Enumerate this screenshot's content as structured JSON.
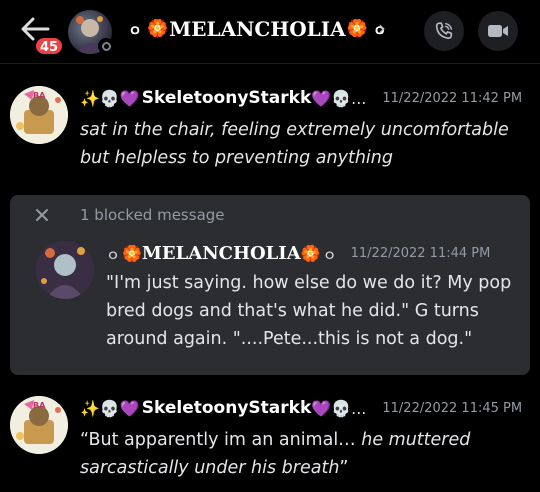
{
  "header": {
    "unread_count": "45",
    "title": "MELANCHOLIA",
    "title_prefix": "ｏ",
    "title_suffix": "ｏ",
    "flower": "🏵️",
    "chevron": "›"
  },
  "messages": [
    {
      "emoji_prefix": "✨💀💜",
      "username": "SkeletoonyStarkk",
      "emoji_suffix": "💜💀...",
      "timestamp": "11/22/2022 11:42 PM",
      "text_italic": "sat in the chair, feeling extremely uncomfortable but helpless to preventing anything"
    },
    {
      "emoji_prefix": "✨💀💜",
      "username": "SkeletoonyStarkk",
      "emoji_suffix": "💜💀...",
      "timestamp": "11/22/2022 11:45 PM",
      "text_plain": "“But apparently im an animal… ",
      "text_italic": "he muttered sarcastically under his breath",
      "text_end": "”"
    }
  ],
  "blocked": {
    "label": "1 blocked message",
    "username": "MELANCHOLIA",
    "name_prefix": "ｏ",
    "name_suffix": "ｏ",
    "flower": "🏵️",
    "timestamp": "11/22/2022 11:44 PM",
    "text": "\"I'm just saying. how else do we do it? My pop bred dogs and that's what he did.\" G turns around again. \"....Pete...this is not a dog.\""
  },
  "colors": {
    "background": "#000000",
    "blocked_bg": "#2b2d31",
    "badge": "#ed4245",
    "muted": "#949ba4"
  },
  "icons": [
    "back-arrow-icon",
    "phone-call-icon",
    "video-camera-icon",
    "close-icon"
  ]
}
